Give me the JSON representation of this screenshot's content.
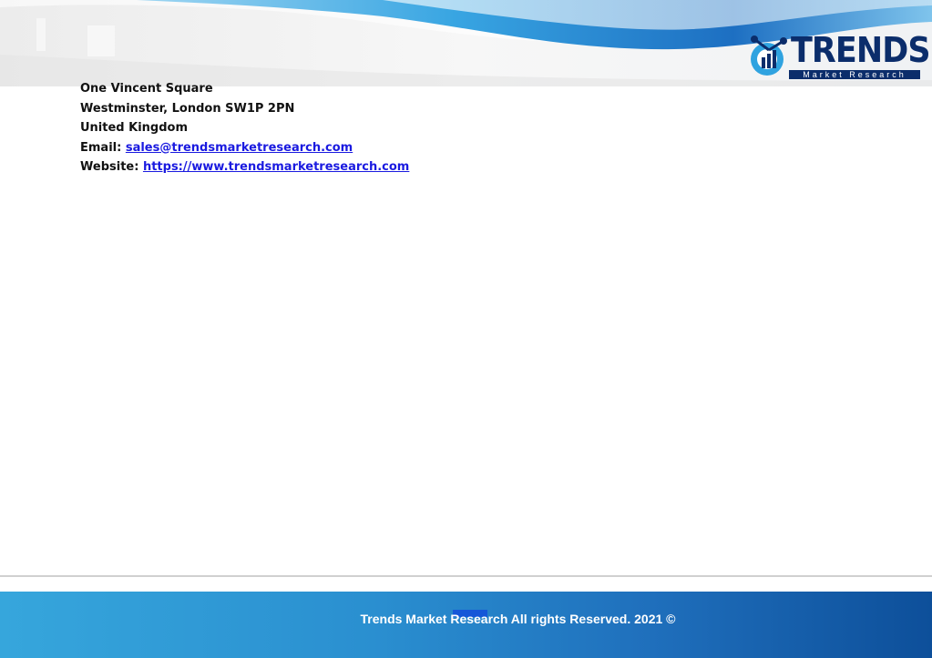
{
  "header": {
    "brand_name": "TRENDS",
    "brand_tagline": "Market Research"
  },
  "address": {
    "line1": "One Vincent Square",
    "line2": "Westminster, London SW1P 2PN",
    "line3": "United Kingdom",
    "email_label": "Email:",
    "email_value": "sales@trendsmarketresearch.com",
    "website_label": "Website:",
    "website_value": "https://www.trendsmarketresearch.com"
  },
  "footer": {
    "copyright": "Trends Market Research All rights Reserved. 2021 ©"
  },
  "colors": {
    "link": "#1a1ae0",
    "brand_dark": "#0b2d6b",
    "brand_accent": "#2fa3e0",
    "footer_start": "#36a6dc",
    "footer_end": "#0d4f9a"
  }
}
